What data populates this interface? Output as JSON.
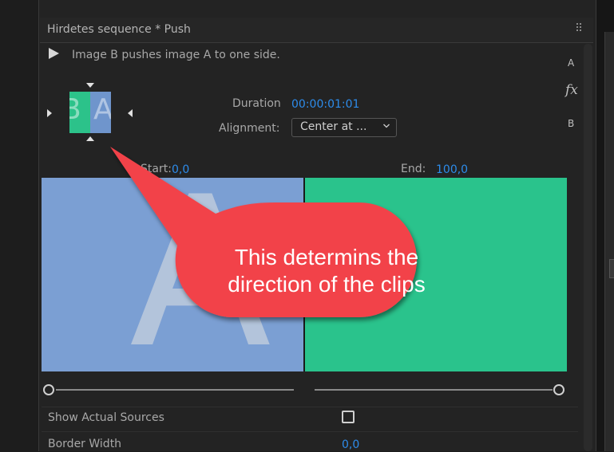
{
  "panel": {
    "title": "Hirdetes sequence * Push",
    "description": "Image B pushes image A to one side."
  },
  "thumbnail": {
    "label_b": "B",
    "label_a": "A",
    "color_b": "#2cc28a",
    "color_a": "#6f95cc"
  },
  "side_labels": {
    "a": "A",
    "fx": "fx",
    "b": "B"
  },
  "duration": {
    "label": "Duration",
    "value": "00:00:01:01"
  },
  "alignment": {
    "label": "Alignment:",
    "value": "Center at ..."
  },
  "start": {
    "label": "Start:",
    "value": "0,0"
  },
  "end": {
    "label": "End:",
    "value": "100,0"
  },
  "preview": {
    "a_label": "A",
    "color_a": "#7b9fd3",
    "color_b": "#2ac38c"
  },
  "properties": {
    "show_actual_sources": {
      "label": "Show Actual Sources",
      "checked": false
    },
    "border_width": {
      "label": "Border Width",
      "value": "0,0"
    }
  },
  "callout": {
    "text_line1": "This determins the",
    "text_line2": "direction of the clips",
    "color": "#f2434a"
  },
  "icons": {
    "play": "play-icon",
    "panel_menu": "panel-menu-icon",
    "dropdown": "chevron-down-icon"
  }
}
